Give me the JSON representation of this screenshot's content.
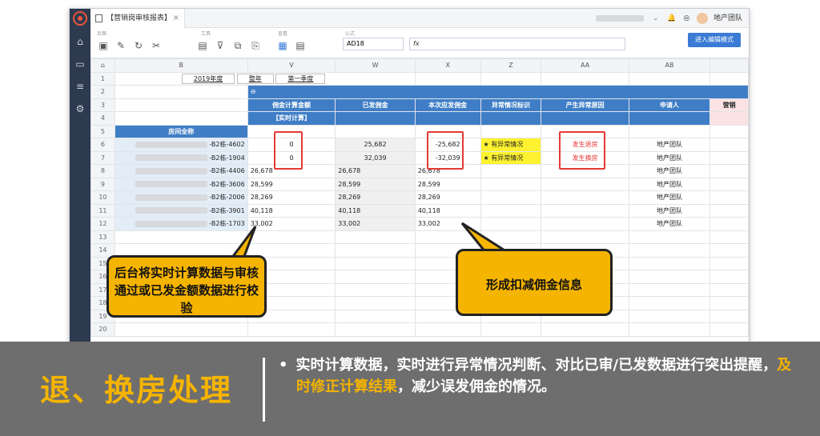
{
  "window": {
    "tab_title": "【营销岗审核报表】",
    "tab_close": "×",
    "username": "地产团队"
  },
  "toolbar": {
    "group_open": "页面",
    "group_tools": "工具",
    "group_view": "查看",
    "group_formula": "公式",
    "cell_ref": "AD18",
    "formula_prefix": "fx",
    "edit_mode_button": "进入编辑模式"
  },
  "sheet": {
    "columns": [
      "B",
      "V",
      "W",
      "X",
      "Z",
      "AA",
      "AB"
    ],
    "row_numbers": [
      "1",
      "2",
      "3",
      "4",
      "5",
      "6",
      "7",
      "8",
      "9",
      "10",
      "11",
      "12",
      "13",
      "14",
      "15",
      "16",
      "17",
      "18",
      "19",
      "20"
    ],
    "filters": [
      "2019年度",
      "整年",
      "第一季度"
    ],
    "headers": {
      "commission_calc": "佣金计算金额",
      "realtime_calc": "【实时计算】",
      "paid_commission": "已发佣金",
      "current_payable": "本次应发佣金",
      "abnormal_flag": "异常情况标识",
      "abnormal_reason": "产生异常原因",
      "applicant": "申请人",
      "extra_col": "营销",
      "room_name": "房间全称"
    },
    "rows": [
      {
        "room": "-B2栋-4602",
        "calc": "0",
        "paid": "25,682",
        "payable": "-25,682",
        "flag": "★ 有异常情况",
        "reason": "发生退房",
        "applicant": "地产团队"
      },
      {
        "room": "-B2栋-1904",
        "calc": "0",
        "paid": "32,039",
        "payable": "-32,039",
        "flag": "★ 有异常情况",
        "reason": "发生换房",
        "applicant": "地产团队"
      },
      {
        "room": "-B2栋-4406",
        "calc": "26,678",
        "paid": "26,678",
        "payable": "26,678",
        "flag": "",
        "reason": "",
        "applicant": "地产团队"
      },
      {
        "room": "-B2栋-3606",
        "calc": "28,599",
        "paid": "28,599",
        "payable": "28,599",
        "flag": "",
        "reason": "",
        "applicant": "地产团队"
      },
      {
        "room": "-B2栋-2006",
        "calc": "28,269",
        "paid": "28,269",
        "payable": "28,269",
        "flag": "",
        "reason": "",
        "applicant": "地产团队"
      },
      {
        "room": "-B2栋-3901",
        "calc": "40,118",
        "paid": "40,118",
        "payable": "40,118",
        "flag": "",
        "reason": "",
        "applicant": "地产团队"
      },
      {
        "room": "-B2栋-1703",
        "calc": "33,002",
        "paid": "33,002",
        "payable": "33,002",
        "flag": "",
        "reason": "",
        "applicant": "地产团队"
      }
    ]
  },
  "callouts": {
    "left": "后台将实时计算数据与审核通过或已发金额数据进行校验",
    "right": "形成扣减佣金信息"
  },
  "summary": {
    "title": "退、换房处理",
    "bullet": "•",
    "text_part1": "实时计算数据，实时进行异常情况判断、对比已审/已发数据进行突出提醒，",
    "text_highlight": "及时修正计算结果",
    "text_part2": "，减少误发佣金的情况。"
  },
  "colors": {
    "accent_blue": "#3f7ec6",
    "highlight_yellow": "#f5b400",
    "alert_red": "#e53935",
    "sidebar": "#2e3a4f"
  }
}
